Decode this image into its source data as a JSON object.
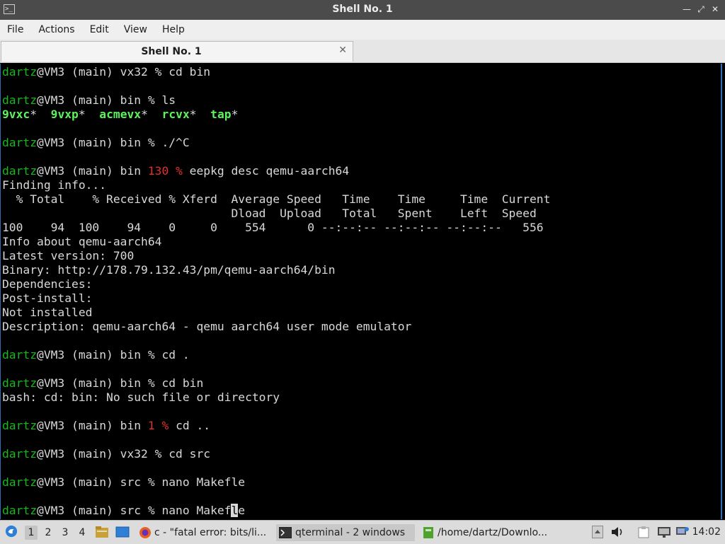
{
  "window": {
    "title": "Shell No. 1",
    "app_icon_text": ">_"
  },
  "menu": {
    "file": "File",
    "actions": "Actions",
    "edit": "Edit",
    "view": "View",
    "help": "Help"
  },
  "tab": {
    "title": "Shell No. 1",
    "close": "✕"
  },
  "terminal": {
    "prompt_user": "dartz",
    "lines": [
      {
        "type": "prompt",
        "user": "dartz",
        "rest": "@VM3 (main) vx32 % cd bin"
      },
      {
        "type": "blank"
      },
      {
        "type": "prompt",
        "user": "dartz",
        "rest": "@VM3 (main) bin % ls"
      },
      {
        "type": "ls",
        "items": [
          "9vxc",
          "9vxp",
          "acmevx",
          "rcvx",
          "tap"
        ]
      },
      {
        "type": "blank"
      },
      {
        "type": "prompt",
        "user": "dartz",
        "rest": "@VM3 (main) bin % ./^C"
      },
      {
        "type": "blank"
      },
      {
        "type": "prompt_code",
        "user": "dartz",
        "pre": "@VM3 (main) bin ",
        "code": "130 %",
        "post": " eepkg desc qemu-aarch64"
      },
      {
        "type": "text",
        "text": "Finding info..."
      },
      {
        "type": "text",
        "text": "  % Total    % Received % Xferd  Average Speed   Time    Time     Time  Current"
      },
      {
        "type": "text",
        "text": "                                 Dload  Upload   Total   Spent    Left  Speed"
      },
      {
        "type": "text",
        "text": "100    94  100    94    0     0    554      0 --:--:-- --:--:-- --:--:--   556"
      },
      {
        "type": "text",
        "text": "Info about qemu-aarch64"
      },
      {
        "type": "text",
        "text": "Latest version: 700"
      },
      {
        "type": "text",
        "text": "Binary: http://178.79.132.43/pm/qemu-aarch64/bin"
      },
      {
        "type": "text",
        "text": "Dependencies:"
      },
      {
        "type": "text",
        "text": "Post-install:"
      },
      {
        "type": "text",
        "text": "Not installed"
      },
      {
        "type": "text",
        "text": "Description: qemu-aarch64 - qemu aarch64 user mode emulator"
      },
      {
        "type": "blank"
      },
      {
        "type": "prompt",
        "user": "dartz",
        "rest": "@VM3 (main) bin % cd ."
      },
      {
        "type": "blank"
      },
      {
        "type": "prompt",
        "user": "dartz",
        "rest": "@VM3 (main) bin % cd bin"
      },
      {
        "type": "text",
        "text": "bash: cd: bin: No such file or directory"
      },
      {
        "type": "blank"
      },
      {
        "type": "prompt_code",
        "user": "dartz",
        "pre": "@VM3 (main) bin ",
        "code": "1 %",
        "post": " cd .."
      },
      {
        "type": "blank"
      },
      {
        "type": "prompt",
        "user": "dartz",
        "rest": "@VM3 (main) vx32 % cd src"
      },
      {
        "type": "blank"
      },
      {
        "type": "prompt",
        "user": "dartz",
        "rest": "@VM3 (main) src % nano Makefle"
      },
      {
        "type": "blank"
      },
      {
        "type": "prompt_cursor",
        "user": "dartz",
        "rest_before": "@VM3 (main) src % nano Makef",
        "cursor": "l",
        "rest_after": "e"
      }
    ]
  },
  "taskbar": {
    "workspaces": [
      "1",
      "2",
      "3",
      "4"
    ],
    "tasks": [
      {
        "label": "c - \"fatal error: bits/li..."
      },
      {
        "label": "qterminal - 2 windows"
      },
      {
        "label": "/home/dartz/Downlo..."
      }
    ],
    "clock": "14:02"
  },
  "colors": {
    "prompt_user": "#16b81c",
    "exit_code": "#e23030",
    "executable": "#5cf25c",
    "terminal_bg": "#000000",
    "titlebar_bg": "#4b4b4b"
  }
}
